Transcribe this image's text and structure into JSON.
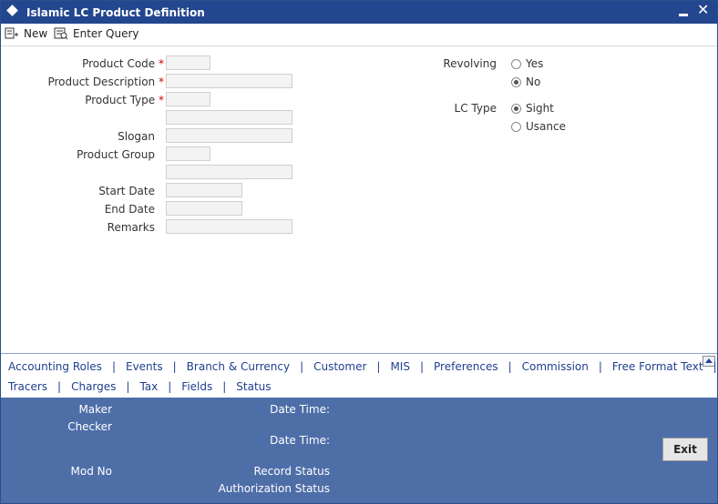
{
  "window": {
    "title": "Islamic LC Product Definition",
    "minimize_symbol": "–",
    "close_symbol": "✕"
  },
  "toolbar": {
    "new_label": "New",
    "enter_query_label": "Enter Query"
  },
  "form": {
    "product_code_label": "Product Code",
    "product_description_label": "Product Description",
    "product_type_label": "Product Type",
    "slogan_label": "Slogan",
    "product_group_label": "Product Group",
    "start_date_label": "Start Date",
    "end_date_label": "End Date",
    "remarks_label": "Remarks",
    "required_marker": "*",
    "revolving_label": "Revolving",
    "revolving_options": [
      "Yes",
      "No"
    ],
    "revolving_selected": "No",
    "lc_type_label": "LC Type",
    "lc_type_options": [
      "Sight",
      "Usance"
    ],
    "lc_type_selected": "Sight"
  },
  "subsystems": {
    "row1": [
      "Accounting Roles",
      "Events",
      "Branch & Currency",
      "Customer",
      "MIS",
      "Preferences",
      "Commission",
      "Free Format Text"
    ],
    "row2": [
      "Tracers",
      "Charges",
      "Tax",
      "Fields",
      "Status"
    ],
    "separator": "|"
  },
  "audit": {
    "maker_label": "Maker",
    "checker_label": "Checker",
    "mod_no_label": "Mod No",
    "date_time_label": "Date Time:",
    "record_status_label": "Record Status",
    "authorization_status_label": "Authorization Status",
    "exit_label": "Exit"
  },
  "colors": {
    "titlebar": "#23478e",
    "audit_bg": "#4e6ea8",
    "link": "#1f3f8f",
    "required": "#cc0000"
  }
}
